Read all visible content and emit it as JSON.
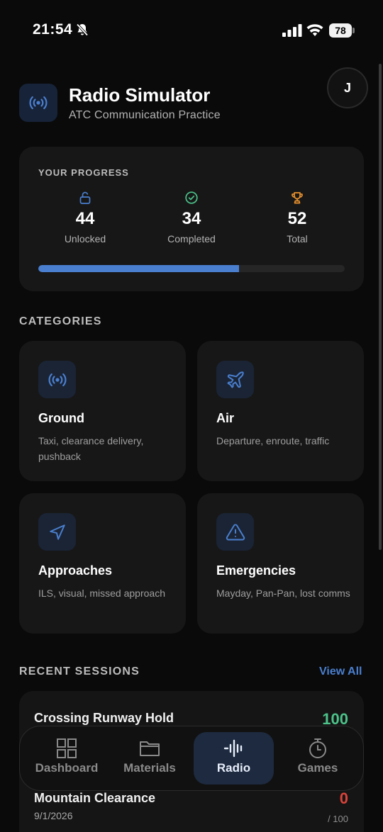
{
  "status_bar": {
    "time": "21:54",
    "battery": "78"
  },
  "header": {
    "title": "Radio Simulator",
    "subtitle": "ATC Communication Practice",
    "avatar_initial": "J"
  },
  "progress": {
    "label": "YOUR PROGRESS",
    "stats": [
      {
        "value": "44",
        "label": "Unlocked",
        "icon": "unlock-icon",
        "color": "#4a7fcf"
      },
      {
        "value": "34",
        "label": "Completed",
        "icon": "check-circle-icon",
        "color": "#4cc38a"
      },
      {
        "value": "52",
        "label": "Total",
        "icon": "trophy-icon",
        "color": "#e8912d"
      }
    ],
    "fill_fraction": 0.654
  },
  "categories": {
    "title": "CATEGORIES",
    "items": [
      {
        "title": "Ground",
        "description": "Taxi, clearance delivery, pushback",
        "icon": "radio-waves-icon"
      },
      {
        "title": "Air",
        "description": "Departure, enroute, traffic",
        "icon": "airplane-icon"
      },
      {
        "title": "Approaches",
        "description": "ILS, visual, missed approach",
        "icon": "navigation-arrow-icon"
      },
      {
        "title": "Emergencies",
        "description": "Mayday, Pan-Pan, lost comms",
        "icon": "warning-triangle-icon"
      }
    ]
  },
  "recent_sessions": {
    "title": "RECENT SESSIONS",
    "view_all": "View All",
    "items": [
      {
        "name": "Crossing Runway Hold",
        "score": "100",
        "score_color": "#4cc38a"
      },
      {
        "name": "Mountain Clearance",
        "date": "9/1/2026",
        "score": "0",
        "max": "/ 100",
        "score_color": "#d9433a"
      }
    ]
  },
  "bottom_nav": {
    "items": [
      {
        "label": "Dashboard",
        "icon": "dashboard-grid-icon"
      },
      {
        "label": "Materials",
        "icon": "folder-icon"
      },
      {
        "label": "Radio",
        "icon": "audio-bars-icon",
        "active": true
      },
      {
        "label": "Games",
        "icon": "stopwatch-icon"
      }
    ]
  },
  "colors": {
    "accent": "#4a7fcf",
    "success": "#4cc38a",
    "danger": "#d9433a",
    "warning": "#e8912d"
  }
}
